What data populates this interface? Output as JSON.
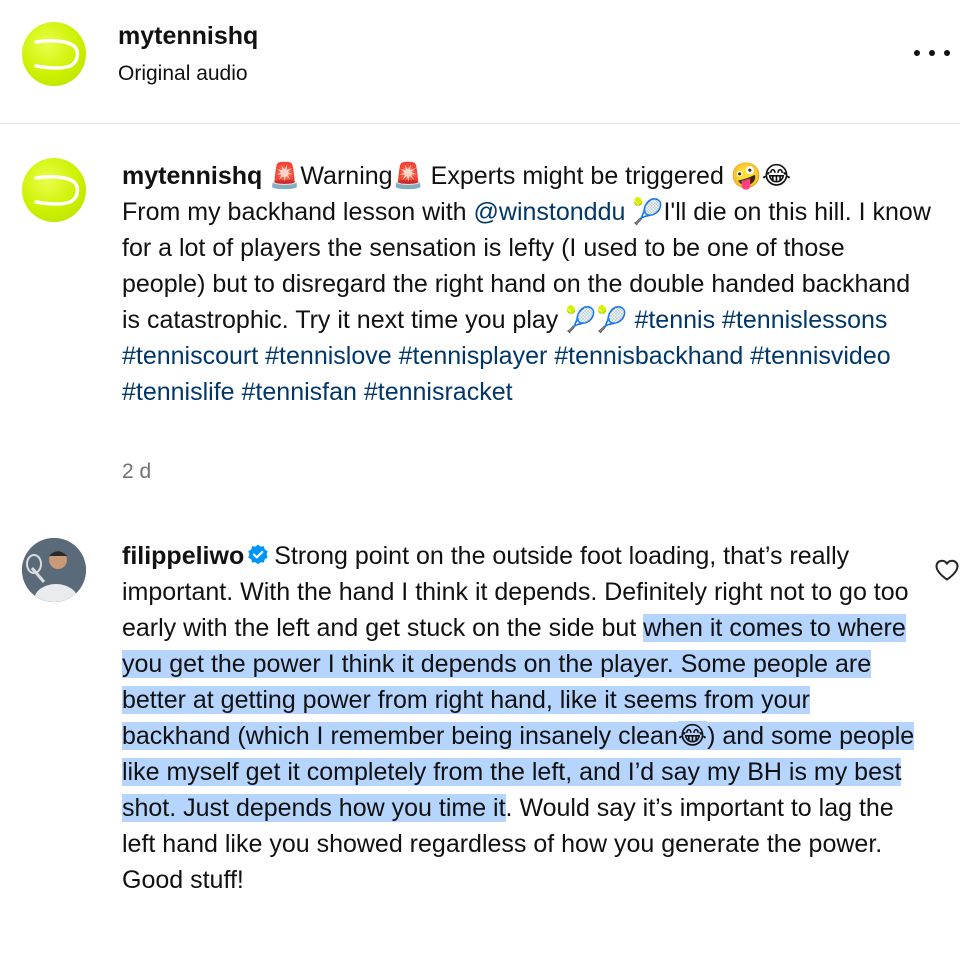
{
  "header": {
    "username": "mytennishq",
    "subtitle": "Original audio",
    "avatar_icon": "tennis-ball-icon",
    "more_icon": "more-options-icon"
  },
  "caption": {
    "username": "mytennishq",
    "siren_emoji": "🚨",
    "text_1": "Warning",
    "text_2": " Experts might be triggered ",
    "laugh_emojis": "🤪😂",
    "text_3": "From my backhand lesson with ",
    "mention": "@winstonddu",
    "ball_emoji": "🎾",
    "text_4": "I'll die on this hill. I know for a lot of players the sensation is lefty (I used to be one of those people) but to disregard the right hand on the double handed backhand is catastrophic. Try it next time you play ",
    "balls_emoji": "🎾🎾",
    "hashtags": [
      "#tennis",
      "#tennislessons",
      "#tenniscourt",
      "#tennislove",
      "#tennisplayer",
      "#tennisbackhand",
      "#tennisvideo",
      "#tennislife",
      "#tennisfan",
      "#tennisracket"
    ],
    "timestamp": "2 d"
  },
  "comment": {
    "username": "filippeliwo",
    "verified_icon": "verified-badge-icon",
    "text_before": "Strong point on the outside foot loading, that’s really important. With the hand I think it depends. Definitely right not to go too early with the left and get stuck on the side but ",
    "highlighted_1": "when it comes to where you get the power I think it depends on the player. Some people are better at getting power from right hand, like it seems from your backhand (which I remember being insanely clean",
    "laugh_emoji": "😂",
    "highlighted_2": ") and some people like myself get it completely from the left, and I’d say my BH is my best shot. Just depends how you time it",
    "text_after": ". Would say it’s important to lag the left hand like you showed regardless of how you generate the power. Good stuff!",
    "like_icon": "heart-icon"
  },
  "colors": {
    "link": "#00376b",
    "selection": "#b5d5ff",
    "verified": "#0095f6",
    "timestamp": "#737373"
  }
}
